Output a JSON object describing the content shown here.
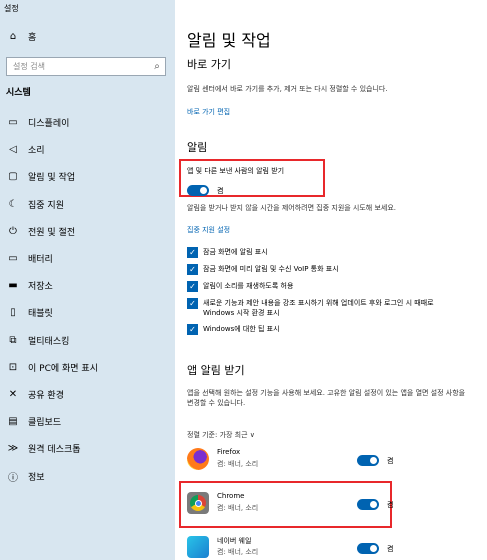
{
  "window": {
    "title": "설정"
  },
  "sidebar": {
    "home_label": "홈",
    "search_placeholder": "설정 검색",
    "section_title": "시스템",
    "items": [
      {
        "label": "디스플레이",
        "icon": "monitor-icon"
      },
      {
        "label": "소리",
        "icon": "speaker-icon"
      },
      {
        "label": "알림 및 작업",
        "icon": "notification-icon"
      },
      {
        "label": "집중 지원",
        "icon": "moon-icon"
      },
      {
        "label": "전원 및 절전",
        "icon": "power-icon"
      },
      {
        "label": "배터리",
        "icon": "battery-icon"
      },
      {
        "label": "저장소",
        "icon": "storage-icon"
      },
      {
        "label": "태블릿",
        "icon": "tablet-icon"
      },
      {
        "label": "멀티태스킹",
        "icon": "multitask-icon"
      },
      {
        "label": "이 PC에 화면 표시",
        "icon": "project-icon"
      },
      {
        "label": "공유 환경",
        "icon": "share-icon"
      },
      {
        "label": "클립보드",
        "icon": "clipboard-icon"
      },
      {
        "label": "원격 데스크톱",
        "icon": "remote-icon"
      },
      {
        "label": "정보",
        "icon": "info-icon"
      }
    ]
  },
  "main": {
    "title": "알림 및 작업",
    "quick_actions": {
      "heading": "바로 가기",
      "description": "알림 센터에서 바로 가기를 추가, 제거 또는 다시 정렬할 수 있습니다.",
      "link": "바로 가기 편집"
    },
    "notifications": {
      "heading": "알림",
      "toggle_label": "앱 및 다른 보낸 사람의 알림 받기",
      "toggle_state": "켬",
      "focus_text": "알림을 받거나 받지 않을 시간을 제어하려면 집중 지원을 시도해 보세요.",
      "focus_link": "집중 지원 설정",
      "checkboxes": [
        "잠금 화면에 알림 표시",
        "잠금 화면에 미리 알림 및 수신 VoIP 통화 표시",
        "알림이 소리를 재생하도록 허용",
        "새로운 기능과 제안 내용을 강조 표시하기 위해 업데이트 후와 로그인 시 때때로 Windows 시작 환경 표시",
        "Windows에 대한 팁 표시"
      ]
    },
    "app_notifications": {
      "heading": "앱 알림 받기",
      "description": "앱을 선택해 원하는 설정 기능을 사용해 보세요. 고유한 알림 설정이 있는 앱을 열면 설정 사항을 변경할 수 있습니다.",
      "sort_label": "정렬 기준: 가장 최근 ∨",
      "apps": [
        {
          "name": "Firefox",
          "sub": "켬: 배너, 소리",
          "state": "켬",
          "icon": "firefox-icon"
        },
        {
          "name": "Chrome",
          "sub": "켬: 배너, 소리",
          "state": "켬",
          "icon": "chrome-icon"
        },
        {
          "name": "네이버 웨일",
          "sub": "켬: 배너, 소리",
          "state": "켬",
          "icon": "whale-icon"
        }
      ]
    }
  },
  "colors": {
    "accent": "#0063b1",
    "sidebar_bg": "#d8e6f0",
    "highlight": "#e8282b"
  }
}
